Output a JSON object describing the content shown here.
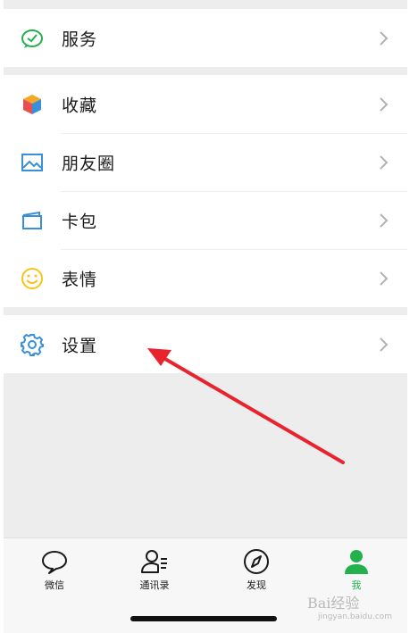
{
  "menu": {
    "service": {
      "label": "服务",
      "icon": "service-icon"
    },
    "favorites": {
      "label": "收藏",
      "icon": "favorites-cube-icon"
    },
    "moments": {
      "label": "朋友圈",
      "icon": "moments-picture-icon"
    },
    "cards": {
      "label": "卡包",
      "icon": "card-wallet-icon"
    },
    "stickers": {
      "label": "表情",
      "icon": "smiley-icon"
    },
    "settings": {
      "label": "设置",
      "icon": "gear-icon"
    }
  },
  "tabbar": {
    "tabs": [
      {
        "label": "微信",
        "icon": "chat-bubble-icon",
        "active": false
      },
      {
        "label": "通讯录",
        "icon": "contacts-icon",
        "active": false
      },
      {
        "label": "发现",
        "icon": "compass-icon",
        "active": false
      },
      {
        "label": "我",
        "icon": "person-icon",
        "active": true
      }
    ]
  },
  "watermark": {
    "text": "Bai经验",
    "sub": "jingyan.baidu.com"
  },
  "colors": {
    "accent": "#22b14c",
    "annotation_arrow": "#e8232e",
    "background": "#ededed"
  }
}
